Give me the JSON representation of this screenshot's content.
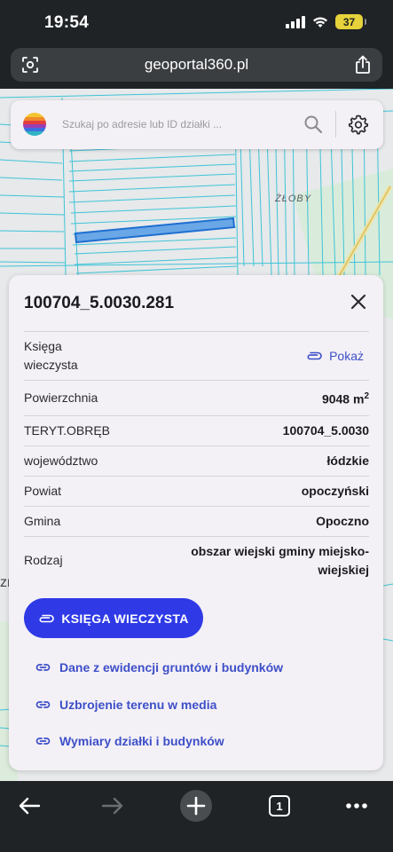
{
  "status_bar": {
    "time": "19:54",
    "battery": "37"
  },
  "browser": {
    "url": "geoportal360.pl"
  },
  "map": {
    "place_label": "ŻŁOBY",
    "edge_text": "zr"
  },
  "search": {
    "placeholder": "Szukaj po adresie lub ID działki ..."
  },
  "panel": {
    "title": "100704_5.0030.281",
    "rows": [
      {
        "label": "Księga wieczysta",
        "link": "Pokaż"
      },
      {
        "label": "Powierzchnia",
        "value": "9048 m",
        "value_sup": "2"
      },
      {
        "label": "TERYT.OBRĘB",
        "value": "100704_5.0030"
      },
      {
        "label": "województwo",
        "value": "łódzkie"
      },
      {
        "label": "Powiat",
        "value": "opoczyński"
      },
      {
        "label": "Gmina",
        "value": "Opoczno"
      },
      {
        "label": "Rodzaj",
        "value": "obszar wiejski gminy miejsko-wiejskiej"
      }
    ],
    "kw_button": "KSIĘGA WIECZYSTA",
    "links": [
      "Dane z ewidencji gruntów i budynków",
      "Uzbrojenie terenu w media",
      "Wymiary działki i budynków"
    ]
  },
  "bottom_bar": {
    "tab_count": "1"
  }
}
